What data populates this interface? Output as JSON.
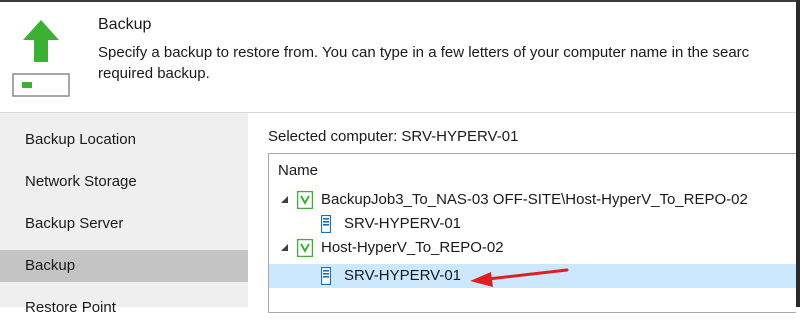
{
  "header": {
    "title": "Backup",
    "description_line1": "Specify a backup to restore from. You can type in a few letters of your computer name in the searc",
    "description_line2": "required backup."
  },
  "sidebar": {
    "items": [
      {
        "label": "Backup Location",
        "active": false
      },
      {
        "label": "Network Storage",
        "active": false
      },
      {
        "label": "Backup Server",
        "active": false
      },
      {
        "label": "Backup",
        "active": true
      },
      {
        "label": "Restore Point",
        "active": false
      }
    ]
  },
  "main": {
    "selected_computer_label": "Selected computer: SRV-HYPERV-01",
    "column_header": "Name",
    "tree": [
      {
        "label": "BackupJob3_To_NAS-03 OFF-SITE\\Host-HyperV_To_REPO-02",
        "type": "job",
        "expanded": true,
        "children": [
          {
            "label": "SRV-HYPERV-01",
            "type": "computer",
            "selected": false
          }
        ]
      },
      {
        "label": "Host-HyperV_To_REPO-02",
        "type": "job",
        "expanded": true,
        "children": [
          {
            "label": "SRV-HYPERV-01",
            "type": "computer",
            "selected": true
          }
        ]
      }
    ]
  },
  "colors": {
    "accent_green": "#3cb034",
    "selection": "#cce8ff",
    "active_nav": "#c4c4c4",
    "sidebar_bg": "#efefef",
    "annotation_arrow": "#e02020"
  },
  "icons": [
    "restore-arrow-icon",
    "backup-job-icon",
    "computer-icon",
    "expand-triangle-icon"
  ]
}
